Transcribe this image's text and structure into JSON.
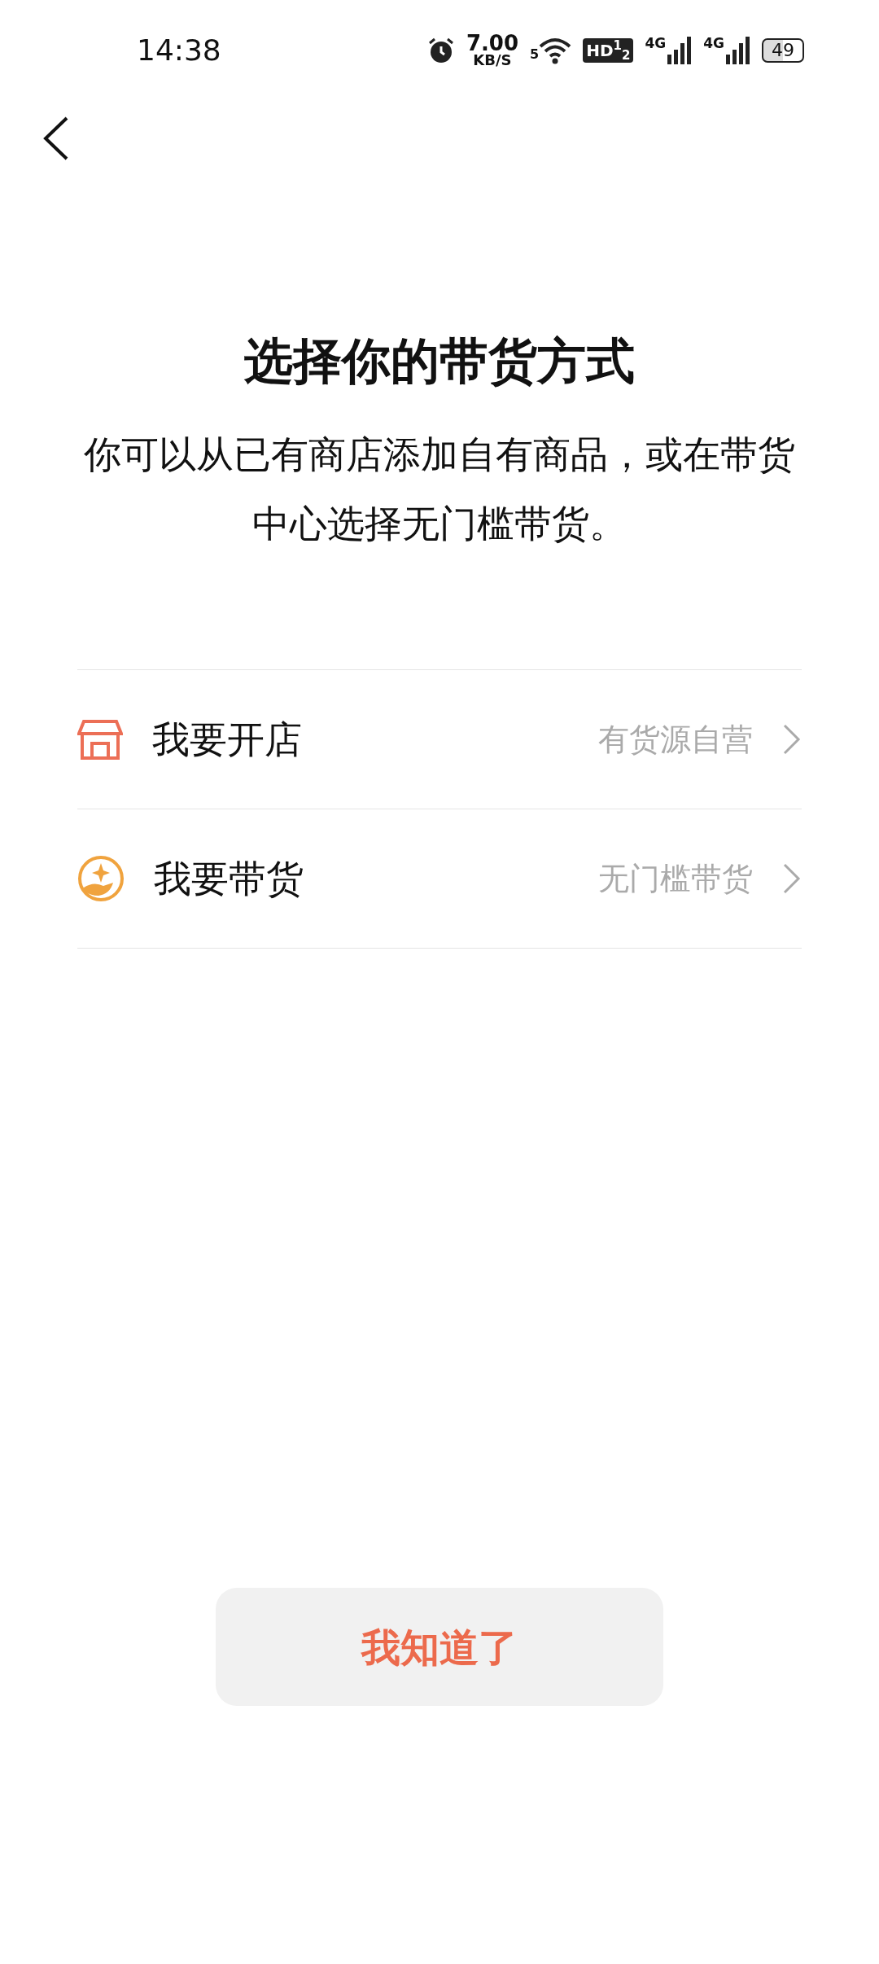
{
  "status_bar": {
    "time": "14:38",
    "net_speed": "7.00",
    "net_unit": "KB/S",
    "wifi_label": "5",
    "hd": "HD$^{1}$$_{2}$",
    "signals": [
      {
        "label": "4G"
      },
      {
        "label": "4G"
      }
    ],
    "battery": "49"
  },
  "title": "选择你的带货方式",
  "description": "你可以从已有商店添加自有商品，或在带货中心选择无门槛带货。",
  "options": [
    {
      "kind": "shop",
      "label": "我要开店",
      "hint": "有货源自营"
    },
    {
      "kind": "sell",
      "label": "我要带货",
      "hint": "无门槛带货"
    }
  ],
  "button": "我知道了"
}
